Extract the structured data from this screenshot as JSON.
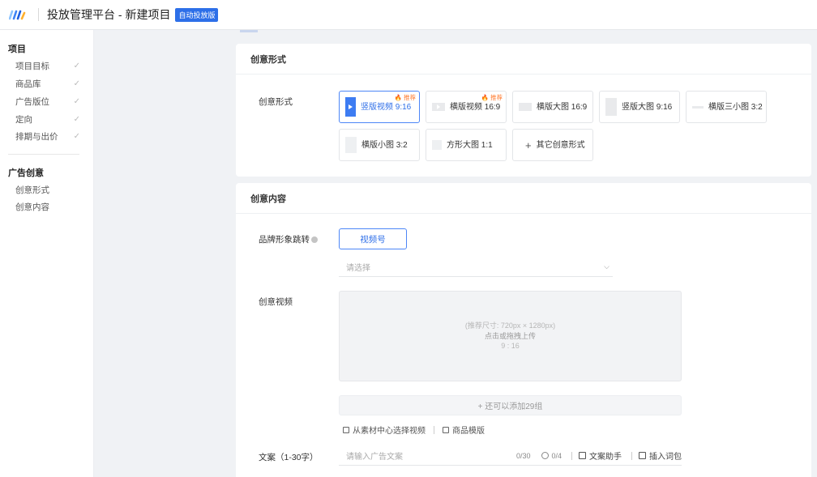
{
  "header": {
    "title": "投放管理平台 - 新建项目",
    "badge": "自动投放版"
  },
  "sidebar": {
    "groups": [
      {
        "title": "项目",
        "items": [
          {
            "label": "项目目标",
            "done": true
          },
          {
            "label": "商品库",
            "done": true
          },
          {
            "label": "广告版位",
            "done": true
          },
          {
            "label": "定向",
            "done": true
          },
          {
            "label": "排期与出价",
            "done": true
          }
        ]
      },
      {
        "title": "广告创意",
        "items": [
          {
            "label": "创意形式",
            "done": false
          },
          {
            "label": "创意内容",
            "done": false
          }
        ]
      }
    ],
    "check_icon": "✓"
  },
  "format_section": {
    "title": "创意形式",
    "field_label": "创意形式",
    "hot_label": "🔥 推荐",
    "options": [
      {
        "label": "竖版视频 9:16",
        "icon": "vertical-video-icon",
        "selected": true,
        "hot": true
      },
      {
        "label": "横版视频 16:9",
        "icon": "horizontal-video-icon",
        "selected": false,
        "hot": true
      },
      {
        "label": "横版大图 16:9",
        "icon": "horizontal-image-icon",
        "selected": false,
        "hot": false
      },
      {
        "label": "竖版大图 9:16",
        "icon": "vertical-image-icon",
        "selected": false,
        "hot": false
      },
      {
        "label": "横版三小图 3:2",
        "icon": "three-images-icon",
        "selected": false,
        "hot": false
      },
      {
        "label": "横版小图 3:2",
        "icon": "small-image-icon",
        "selected": false,
        "hot": false
      },
      {
        "label": "方形大图 1:1",
        "icon": "square-image-icon",
        "selected": false,
        "hot": false
      }
    ],
    "other_label": "其它创意形式",
    "other_icon": "+"
  },
  "content_section": {
    "title": "创意内容",
    "brand_label": "品牌形象跳转",
    "brand_button": "视频号",
    "select_placeholder": "请选择",
    "chevron": "⌵",
    "video_label": "创意视频",
    "upload": {
      "size_hint": "(推荐尺寸: 720px × 1280px)",
      "action": "点击或拖拽上传",
      "ratio": "9 : 16"
    },
    "add_more": "+ 还可以添加29组",
    "material_link": "从素材中心选择视频",
    "template_link": "商品模版",
    "copy_label": "文案（1-30字）",
    "copy_placeholder": "请输入广告文案",
    "copy_count": "0/30",
    "emoji_count": "0/4",
    "assistant_label": "文案助手",
    "insert_label": "插入词包"
  },
  "colors": {
    "primary": "#2f6fe8",
    "hot": "#ff7a2d",
    "page_bg": "#f0f2f5"
  }
}
